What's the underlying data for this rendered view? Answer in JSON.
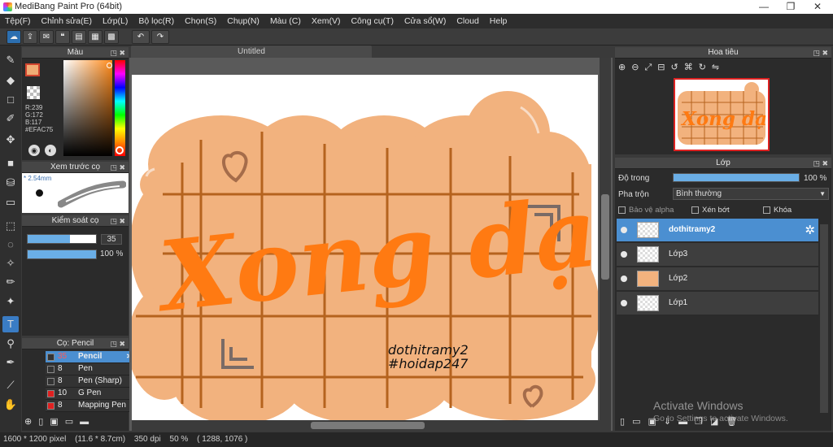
{
  "window": {
    "title": "MediBang Paint Pro (64bit)",
    "minimize": "—",
    "maximize": "❐",
    "close": "✕"
  },
  "menu": [
    "Tệp(F)",
    "Chỉnh sửa(E)",
    "Lớp(L)",
    "Bộ lọc(R)",
    "Chọn(S)",
    "Chụp(N)",
    "Màu (C)",
    "Xem(V)",
    "Công cụ(T)",
    "Cửa sổ(W)",
    "Cloud",
    "Help"
  ],
  "color_panel": {
    "title": "Màu",
    "r": "R:239",
    "g": "G:172",
    "b": "B:117",
    "hex": "#EFAC75",
    "accent": "#EFAC75"
  },
  "brush_preview": {
    "title": "Xem trước cọ",
    "size": "* 2.54mm"
  },
  "brush_control": {
    "title": "Kiểm soát cọ",
    "size_value": "35",
    "size_fill": 0.62,
    "opacity_value": "100 %",
    "opacity_fill": 1.0
  },
  "brush_list": {
    "title": "Cọ: Pencil",
    "items": [
      {
        "size": "35",
        "name": "Pencil",
        "color": "#333333",
        "selected": true
      },
      {
        "size": "8",
        "name": "Pen",
        "color": "#333333",
        "selected": false
      },
      {
        "size": "8",
        "name": "Pen (Sharp)",
        "color": "#333333",
        "selected": false
      },
      {
        "size": "10",
        "name": "G Pen",
        "color": "#e02020",
        "selected": false
      },
      {
        "size": "8",
        "name": "Mapping Pen",
        "color": "#e02020",
        "selected": false
      }
    ]
  },
  "canvas": {
    "tab": "Untitled",
    "title_text": "Xong dạn",
    "signature_line1": "dothitramy2",
    "signature_line2": "#hoidap247",
    "blob_color": "#F2B27E",
    "grid_color": "#B5631E",
    "text_color": "#FF7A12"
  },
  "navigator": {
    "title": "Hoa tiêu",
    "thumb_text": "Xong dạn"
  },
  "layer_panel": {
    "title": "Lớp",
    "opacity_label": "Độ trong",
    "opacity_value": "100 %",
    "blend_label": "Pha trộn",
    "blend_value": "Bình thường",
    "protect_alpha": "Bảo vệ alpha",
    "clipping": "Xén bớt",
    "lock": "Khóa",
    "layers": [
      {
        "name": "dothitramy2",
        "selected": true
      },
      {
        "name": "Lớp3",
        "selected": false
      },
      {
        "name": "Lớp2",
        "selected": false
      },
      {
        "name": "Lớp1",
        "selected": false
      }
    ]
  },
  "status": {
    "size_px": "1600 * 1200 pixel",
    "size_cm": "(11.6 * 8.7cm)",
    "dpi": "350 dpi",
    "zoom": "50 %",
    "cursor": "( 1288, 1076 )"
  },
  "watermark": {
    "line1": "Activate Windows",
    "line2": "Go to Settings to activate Windows."
  }
}
